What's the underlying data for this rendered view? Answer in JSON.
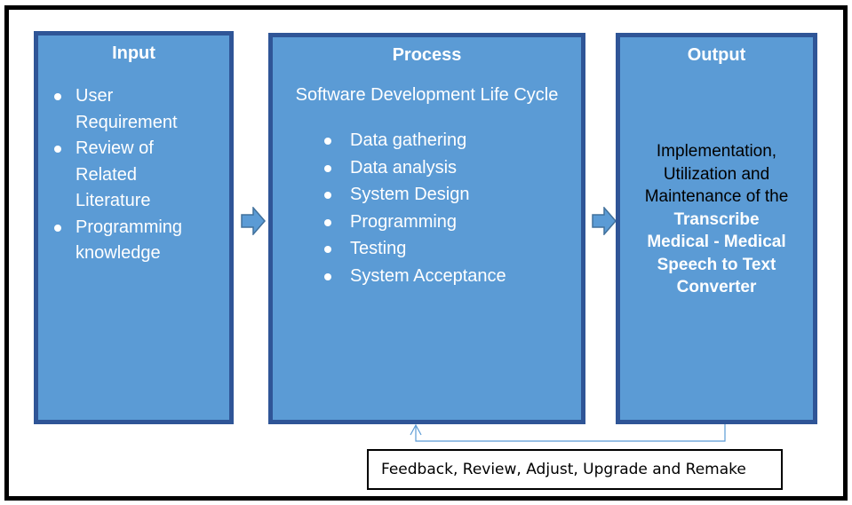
{
  "colors": {
    "box_fill": "#5b9bd5",
    "box_border": "#2f5597",
    "box_text": "#ffffff",
    "frame_border": "#000000",
    "feedback_line": "#5b9bd5"
  },
  "input": {
    "title": "Input",
    "items": [
      {
        "lines": [
          "User",
          "Requirement"
        ]
      },
      {
        "lines": [
          "Review of",
          "Related",
          "Literature"
        ]
      },
      {
        "lines": [
          "Programming",
          "knowledge"
        ]
      }
    ]
  },
  "process": {
    "title": "Process",
    "subtitle": "Software Development Life Cycle",
    "items": [
      "Data gathering",
      "Data analysis",
      "System Design",
      "Programming",
      "Testing",
      "System Acceptance"
    ]
  },
  "output": {
    "title": "Output",
    "plain_lines": [
      "Implementation,",
      "Utilization and",
      "Maintenance of the"
    ],
    "bold_lines": [
      "Transcribe",
      "Medical  - Medical",
      "Speech to Text",
      "Converter"
    ]
  },
  "arrows": {
    "icon_1": "right-block-arrow-icon",
    "icon_2": "right-block-arrow-icon",
    "feedback": "feedback-loop-arrow-icon"
  },
  "feedback": {
    "label": "Feedback, Review, Adjust, Upgrade and Remake"
  }
}
